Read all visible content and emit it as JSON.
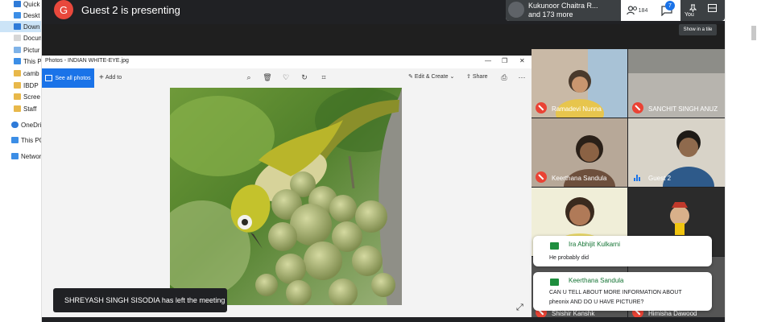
{
  "explorer": {
    "items": [
      {
        "label": "Quick a",
        "color": "#2f7bd8"
      },
      {
        "label": "Deskt",
        "color": "#3c8ee6"
      },
      {
        "label": "Down",
        "color": "#2f7bd8"
      },
      {
        "label": "Docum",
        "color": "#d6d6d6"
      },
      {
        "label": "Pictur",
        "color": "#7fb3e8"
      },
      {
        "label": "This P",
        "color": "#3c8ee6"
      },
      {
        "label": "camb",
        "color": "#e8b84a"
      },
      {
        "label": "IBDP",
        "color": "#e8b84a"
      },
      {
        "label": "Scree",
        "color": "#e8b84a"
      },
      {
        "label": "Staff",
        "color": "#e8b84a"
      },
      {
        "label": "OneDri",
        "color": "#2f7bd8"
      },
      {
        "label": "This PC",
        "color": "#3c8ee6"
      },
      {
        "label": "Networ",
        "color": "#3c8ee6"
      }
    ]
  },
  "meet": {
    "presenter_initial": "G",
    "presenting_text": "Guest 2 is presenting",
    "presenter_card": {
      "name": "Kukunoor Chaitra R...",
      "others": "and 173 more"
    },
    "participants_count": "184",
    "chat_badge": "7",
    "self_label": "You",
    "tooltip": "Show in a tile"
  },
  "photos": {
    "title": "Photos - INDIAN WHITE-EYE.jpg",
    "see_all": "See all photos",
    "add_to": "Add to",
    "edit_create": "Edit & Create",
    "share": "Share"
  },
  "toast": "SHREYASH SINGH SISODIA has left the meeting",
  "tiles": [
    {
      "name": "Ramadevi Nunna",
      "state": "muted",
      "bg": "#c9b9a6"
    },
    {
      "name": "SANCHIT SINGH ANUZ",
      "state": "muted",
      "bg": "#3a3a3a"
    },
    {
      "name": "Keerthana Sandula",
      "state": "muted",
      "bg": "#b7a898"
    },
    {
      "name": "Guest 2",
      "state": "speaking",
      "bg": "#d8d3c8"
    },
    {
      "name": "",
      "state": "none",
      "bg": "#e8d86a"
    },
    {
      "name": "",
      "state": "none",
      "bg": "#2b2b2b"
    },
    {
      "name": "Shishir Kanshk",
      "state": "muted",
      "bg": "#555555"
    },
    {
      "name": "Himisha Dawood",
      "state": "muted",
      "bg": "#555555"
    }
  ],
  "chats": [
    {
      "sender": "Ira Abhijit Kulkarni",
      "message": "He probably did"
    },
    {
      "sender": "Keerthana Sandula",
      "message": "CAN U TELL ABOUT MORE INFORMATION ABOUT pheonix AND DO U HAVE PICTURE?"
    }
  ],
  "colors": {
    "accent": "#1a73e8",
    "muted_red": "#ea4335",
    "chat_green": "#137333",
    "meet_dark": "#202124"
  }
}
